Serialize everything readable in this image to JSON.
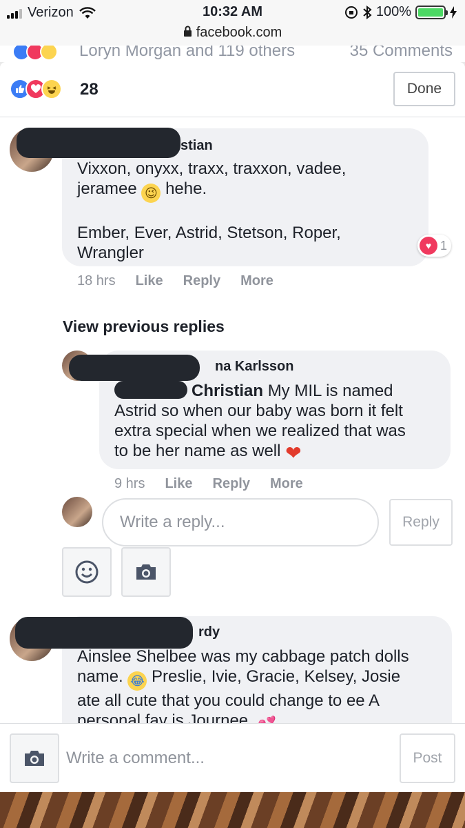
{
  "status_bar": {
    "carrier": "Verizon",
    "time": "10:32 AM",
    "battery": "100%"
  },
  "url": "facebook.com",
  "behind": {
    "reactors_text": "Loryn Morgan and 119 others",
    "comments_count_text": "35 Comments"
  },
  "header": {
    "reaction_count": "28",
    "done_label": "Done"
  },
  "comments": [
    {
      "author_visible": "stian",
      "line1": "Vixxon, onyxx, traxx, traxxon, vadee,",
      "line2a": "jeramee",
      "line2b": "hehe.",
      "line3": "Ember, Ever, Astrid, Stetson, Roper,",
      "line4": "Wrangler",
      "reaction_count": "1",
      "time": "18 hrs",
      "like": "Like",
      "reply": "Reply",
      "more": "More"
    }
  ],
  "view_previous_replies": "View previous replies",
  "reply": {
    "author_visible": "na Karlsson",
    "mention": "Christian",
    "line1": "My MIL is named",
    "line2": "Astrid so when our baby was born it felt",
    "line3": "extra special when we realized that was",
    "line4": "to be her name as well",
    "time": "9 hrs",
    "like": "Like",
    "reply": "Reply",
    "more": "More"
  },
  "reply_composer": {
    "placeholder": "Write a reply...",
    "button": "Reply"
  },
  "comment2": {
    "author_visible": "rdy",
    "line1": "Ainslee Shelbee was my cabbage patch dolls",
    "line2a": "name.",
    "line2b": "Preslie, Ivie, Gracie, Kelsey, Josie",
    "line3": "ate all cute that you could change to ee A",
    "line4": "personal fav is Journee."
  },
  "composer": {
    "placeholder": "Write a comment...",
    "post_label": "Post"
  },
  "colors": {
    "like_blue": "#3b7cf5",
    "love_red": "#f0395e",
    "haha_yellow": "#fcd450",
    "bubble_gray": "#f0f1f4"
  }
}
